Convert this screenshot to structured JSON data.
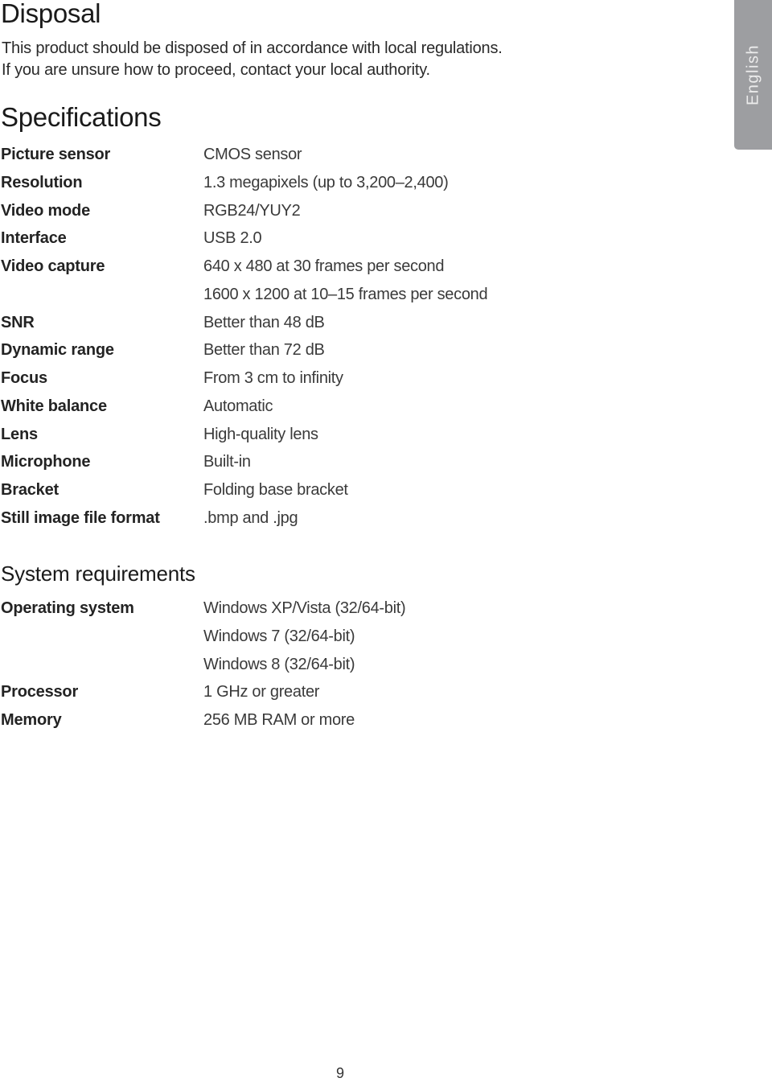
{
  "disposal": {
    "title": "Disposal",
    "lines": [
      "This product should be disposed of in accordance with local regulations.",
      "If you are unsure how to proceed, contact your local authority."
    ]
  },
  "specifications": {
    "title": "Specifications",
    "rows": [
      {
        "label": "Picture sensor",
        "value": "CMOS sensor"
      },
      {
        "label": "Resolution",
        "value": "1.3 megapixels (up to 3,200–2,400)"
      },
      {
        "label": "Video mode",
        "value": "RGB24/YUY2"
      },
      {
        "label": "Interface",
        "value": "USB 2.0"
      },
      {
        "label": "Video capture",
        "value": "640 x 480 at 30 frames per second"
      },
      {
        "label": "",
        "value": "1600 x 1200 at 10–15 frames per second"
      },
      {
        "label": "SNR",
        "value": "Better than 48 dB"
      },
      {
        "label": "Dynamic range",
        "value": "Better than 72 dB"
      },
      {
        "label": "Focus",
        "value": "From 3 cm to infinity"
      },
      {
        "label": "White balance",
        "value": "Automatic"
      },
      {
        "label": "Lens",
        "value": "High-quality lens"
      },
      {
        "label": "Microphone",
        "value": "Built-in"
      },
      {
        "label": "Bracket",
        "value": "Folding base bracket"
      },
      {
        "label": "Still image file format",
        "value": ".bmp and .jpg"
      }
    ]
  },
  "system_requirements": {
    "title": "System requirements",
    "rows": [
      {
        "label": "Operating system",
        "value": "Windows XP/Vista (32/64-bit)"
      },
      {
        "label": "",
        "value": "Windows 7 (32/64-bit)"
      },
      {
        "label": "",
        "value": "Windows 8 (32/64-bit)"
      },
      {
        "label": "Processor",
        "value": "1 GHz or greater"
      },
      {
        "label": "Memory",
        "value": "256 MB RAM or more"
      }
    ]
  },
  "language_tab": {
    "label": "English",
    "color": "#9d9ea1"
  },
  "page_number": "9"
}
